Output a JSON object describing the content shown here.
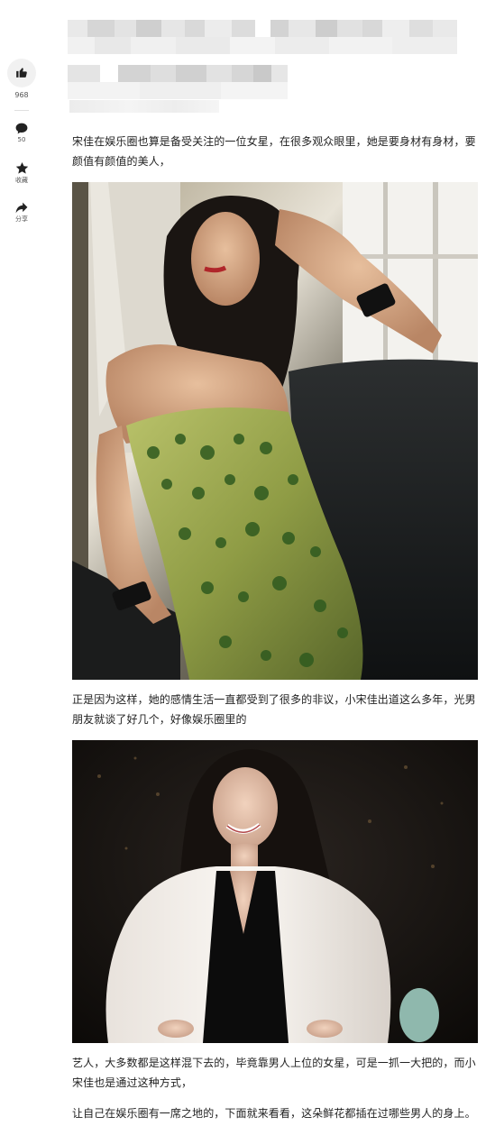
{
  "sidebar": {
    "like_count": "968",
    "comment_count": "50",
    "favorite_label": "收藏",
    "share_label": "分享",
    "icons": {
      "like": "thumbs-up-icon",
      "comment": "comment-bubble-icon",
      "favorite": "star-icon",
      "share": "share-arrow-icon"
    }
  },
  "article": {
    "paragraphs": [
      "宋佳在娱乐圈也算是备受关注的一位女星，在很多观众眼里，她是要身材有身材，要颜值有颜值的美人，",
      "正是因为这样，她的感情生活一直都受到了很多的非议，小宋佳出道这么多年，光男朋友就谈了好几个，好像娱乐圈里的",
      "艺人，大多数都是这样混下去的，毕竟靠男人上位的女星，可是一抓一大把的，而小宋佳也是通过这种方式，",
      "让自己在娱乐圈有一席之地的，下面就来看看，这朵鲜花都插在过哪些男人的身上。"
    ]
  },
  "colors": {
    "icon": "#222222",
    "text": "#222222",
    "muted": "#555555",
    "background": "#ffffff"
  }
}
